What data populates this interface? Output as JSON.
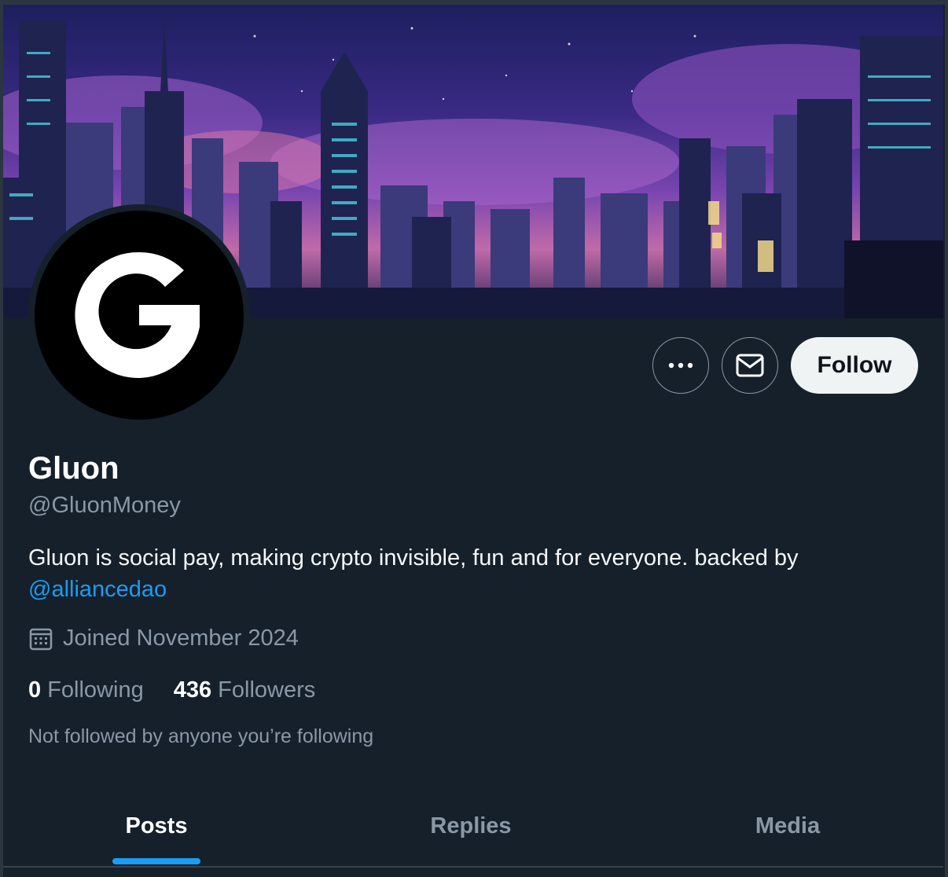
{
  "profile": {
    "name": "Gluon",
    "handle": "@GluonMoney",
    "bio_text": "Gluon is social pay, making crypto invisible, fun and for everyone. backed by ",
    "bio_mention": "@alliancedao",
    "joined": "Joined November 2024",
    "following_count": "0",
    "following_label": "Following",
    "followers_count": "436",
    "followers_label": "Followers",
    "not_followed": "Not followed by anyone you’re following"
  },
  "actions": {
    "more_icon": "more-horizontal-icon",
    "message_icon": "envelope-icon",
    "follow_label": "Follow"
  },
  "tabs": [
    {
      "label": "Posts",
      "active": true
    },
    {
      "label": "Replies",
      "active": false
    },
    {
      "label": "Media",
      "active": false
    }
  ],
  "colors": {
    "background": "#15202b",
    "accent": "#1d9bf0",
    "secondary_text": "#8b98a5",
    "follow_button": "#eff3f4"
  }
}
